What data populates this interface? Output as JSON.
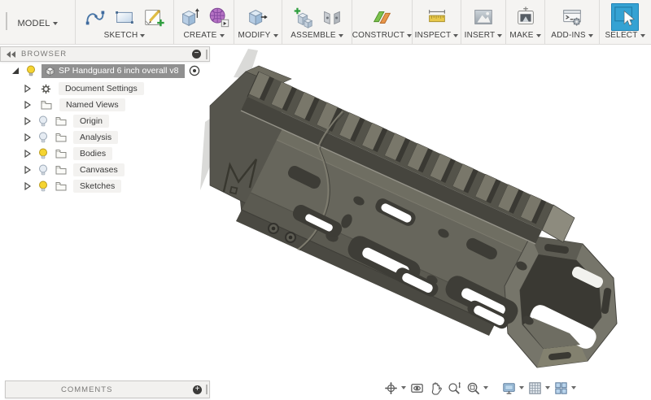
{
  "toolbar": {
    "workspace_label": "MODEL",
    "groups": [
      {
        "label": "SKETCH",
        "icons": [
          "spline-icon",
          "two-point-rectangle-icon",
          "create-sketch-icon"
        ]
      },
      {
        "label": "CREATE",
        "icons": [
          "extrude-icon",
          "form-icon"
        ]
      },
      {
        "label": "MODIFY",
        "icons": [
          "press-pull-icon"
        ]
      },
      {
        "label": "ASSEMBLE",
        "icons": [
          "new-component-icon",
          "joint-icon"
        ]
      },
      {
        "label": "CONSTRUCT",
        "icons": [
          "construction-plane-icon"
        ]
      },
      {
        "label": "INSPECT",
        "icons": [
          "measure-icon"
        ]
      },
      {
        "label": "INSERT",
        "icons": [
          "insert-image-icon"
        ]
      },
      {
        "label": "MAKE",
        "icons": [
          "make-3d-print-icon"
        ]
      },
      {
        "label": "ADD-INS",
        "icons": [
          "scripts-addins-icon"
        ]
      },
      {
        "label": "SELECT",
        "icons": [
          "select-cursor-icon"
        ],
        "active": true
      }
    ]
  },
  "browser": {
    "header": {
      "title": "BROWSER",
      "collapse_icon": "collapse-panel-icon",
      "minimize_icon": "minus-circle-icon"
    },
    "root": {
      "label": "SP Handguard 6 inch overall v8",
      "visibility": "on",
      "selected": true,
      "icons": [
        "expanded-triangle-icon",
        "bulb-on-icon",
        "component-cube-icon",
        "activate-component-radio-icon"
      ]
    },
    "items": [
      {
        "label": "Document Settings",
        "icon": "gear-icon",
        "bulb": null
      },
      {
        "label": "Named Views",
        "icon": "folder-icon",
        "bulb": null
      },
      {
        "label": "Origin",
        "icon": "folder-icon",
        "bulb": "off"
      },
      {
        "label": "Analysis",
        "icon": "folder-icon",
        "bulb": "off"
      },
      {
        "label": "Bodies",
        "icon": "folder-icon",
        "bulb": "on"
      },
      {
        "label": "Canvases",
        "icon": "folder-icon",
        "bulb": "off"
      },
      {
        "label": "Sketches",
        "icon": "folder-icon",
        "bulb": "on"
      }
    ]
  },
  "comments_panel": {
    "title": "COMMENTS",
    "add_icon": "plus-circle-icon"
  },
  "viewport": {
    "model_name": "SP Handguard 6 inch overall v8",
    "description": "Dark olive-gray free-float M-LOK handguard with picatinny top rail, octagonal front opening, engraved M logo on rear clamp block, rendered in shaded view on white canvas",
    "colors": {
      "body": "#67665c",
      "rail_dark": "#54534a",
      "slot_dark": "#3d3c36",
      "front_face": "#7b7a6e",
      "edge_highlight": "#96948a",
      "ghost": "#dadad8"
    }
  },
  "nav_toolbar": {
    "icons": [
      {
        "name": "orbit-icon",
        "dropdown": true
      },
      {
        "name": "look-at-icon",
        "dropdown": false
      },
      {
        "name": "pan-icon",
        "dropdown": false
      },
      {
        "name": "zoom-icon",
        "dropdown": false
      },
      {
        "name": "fit-icon",
        "dropdown": true
      },
      {
        "name": "display-settings-icon",
        "dropdown": true
      },
      {
        "name": "grid-settings-icon",
        "dropdown": true
      },
      {
        "name": "viewports-icon",
        "dropdown": true
      }
    ]
  },
  "colors": {
    "toolbar_bg": "#f5f4f2",
    "panel_bg": "#f2f1ef",
    "selection_bg": "#909090",
    "select_active": "#35a2d3"
  }
}
